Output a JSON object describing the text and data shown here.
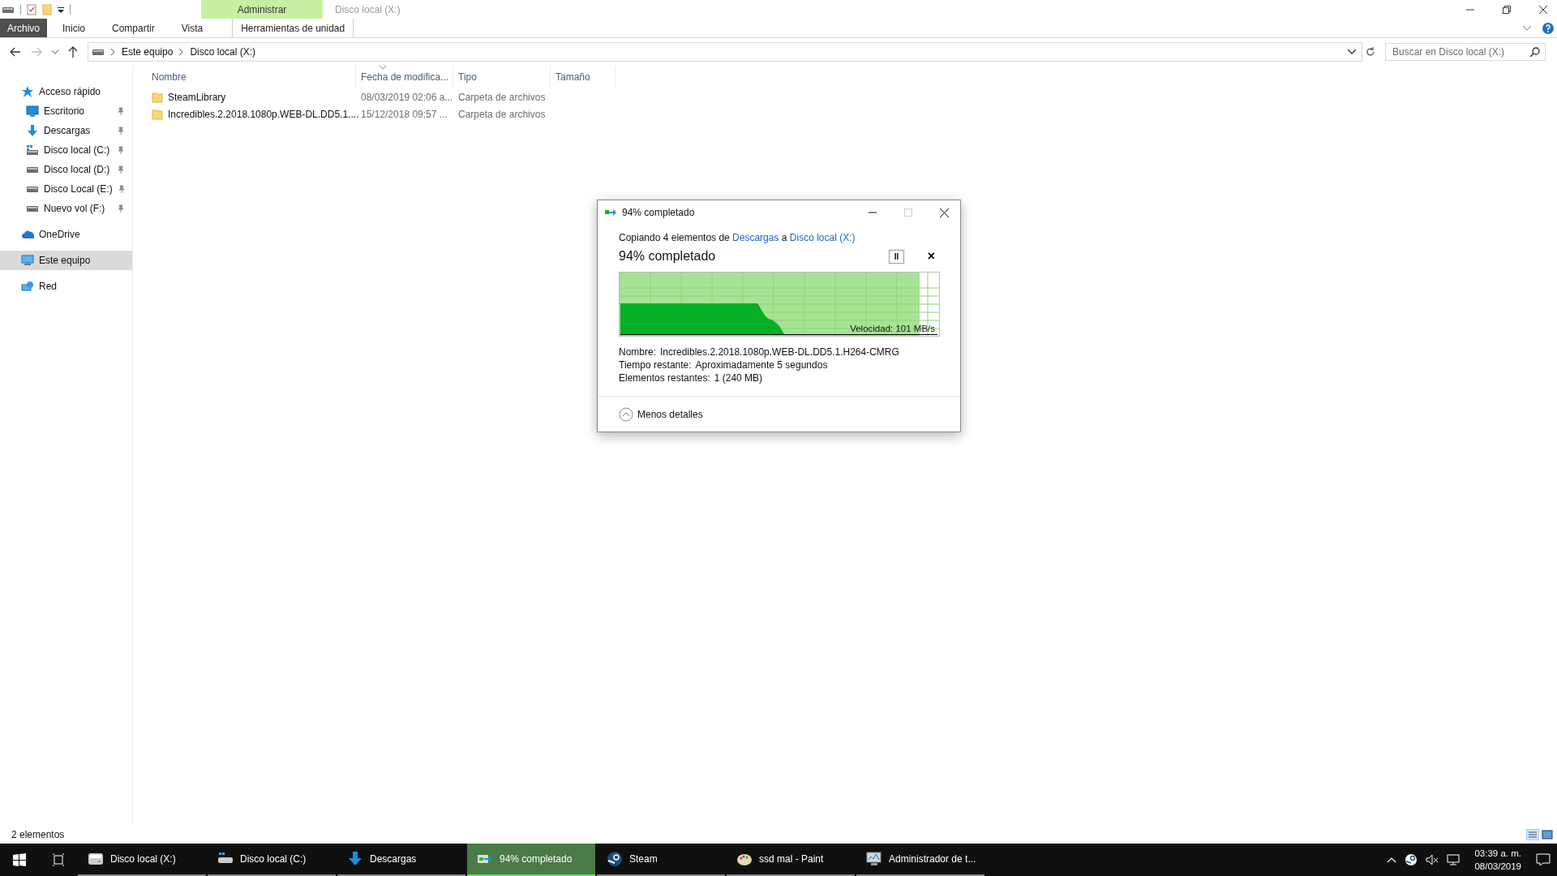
{
  "window": {
    "title": "Disco local (X:)",
    "context_tab_group": "Administrar"
  },
  "ribbon_tabs": [
    {
      "label": "Archivo",
      "kind": "file",
      "selected": false
    },
    {
      "label": "Inicio",
      "kind": "tab",
      "selected": false
    },
    {
      "label": "Compartir",
      "kind": "tab",
      "selected": false
    },
    {
      "label": "Vista",
      "kind": "tab",
      "selected": false
    },
    {
      "label": "Herramientas de unidad",
      "kind": "context",
      "selected": false
    }
  ],
  "address": {
    "crumbs": [
      "Este equipo",
      "Disco local (X:)"
    ]
  },
  "search": {
    "placeholder": "Buscar en Disco local (X:)"
  },
  "sidebar": {
    "items": [
      {
        "label": "Acceso rápido",
        "selected": false,
        "children": [
          {
            "label": "Escritorio",
            "pinned": true,
            "selected": false
          },
          {
            "label": "Descargas",
            "pinned": true,
            "selected": false
          },
          {
            "label": "Disco local (C:)",
            "pinned": true,
            "selected": false
          },
          {
            "label": "Disco local (D:)",
            "pinned": true,
            "selected": false
          },
          {
            "label": "Disco Local (E:)",
            "pinned": true,
            "selected": false
          },
          {
            "label": "Nuevo vol (F:)",
            "pinned": true,
            "selected": false
          }
        ]
      },
      {
        "label": "OneDrive",
        "selected": false
      },
      {
        "label": "Este equipo",
        "selected": true
      },
      {
        "label": "Red",
        "selected": false
      }
    ]
  },
  "table": {
    "columns": [
      "Nombre",
      "Fecha de modifica...",
      "Tipo",
      "Tamaño"
    ],
    "rows": [
      [
        "SteamLibrary",
        "08/03/2019 02:06 a...",
        "Carpeta de archivos"
      ],
      [
        "Incredibles.2.2018.1080p.WEB-DL.DD5.1....",
        "15/12/2018 09:57 ...",
        "Carpeta de archivos"
      ]
    ]
  },
  "status_bar": {
    "count": "2 elementos"
  },
  "copy_dialog": {
    "title": "94% completado",
    "copy_line": {
      "before": "Copiando 4 elementos de ",
      "source": "Descargas",
      "middle": " a ",
      "destination": "Disco local (X:)"
    },
    "heading": "94% completado",
    "pause_label": "II",
    "cancel_label": "×",
    "progress": {
      "level": 0.94,
      "speed": "Velocidad: 101 MB/s"
    },
    "details": [
      {
        "label": "Nombre:",
        "value": "Incredibles.2.2018.1080p.WEB-DL.DD5.1.H264-CMRG"
      },
      {
        "label": "Tiempo restante:",
        "value": "Aproximadamente 5 segundos"
      },
      {
        "label": "Elementos restantes:",
        "value": "1 (240 MB)"
      }
    ],
    "toggle": "Menos detalles"
  },
  "taskbar": {
    "items": [
      {
        "label": "Disco local (X:)",
        "selected": false
      },
      {
        "label": "Disco local (C:)",
        "selected": false
      },
      {
        "label": "Descargas",
        "selected": false
      },
      {
        "label": "94% completado",
        "selected": true
      },
      {
        "label": "Steam",
        "selected": false
      },
      {
        "label": "ssd mal - Paint",
        "selected": false
      },
      {
        "label": "Administrador de t...",
        "selected": false
      }
    ],
    "clock": {
      "time": "03:39 a. m.",
      "date": "08/03/2019"
    }
  }
}
